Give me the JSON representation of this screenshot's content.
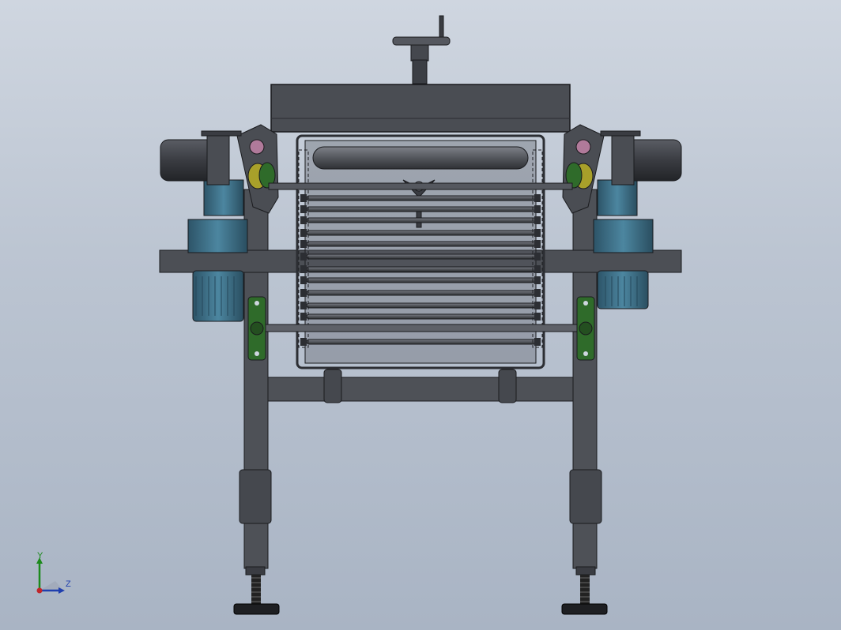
{
  "viewport": {
    "background_top": "#cfd6e0",
    "background_bottom": "#a9b4c4"
  },
  "model": {
    "subject": "roller-chain-conveyor-assembly",
    "colors": {
      "frame": "#4e5157",
      "frame_dark": "#2c2e33",
      "frame_edge": "#1a1b1e",
      "motor": "#3a3c42",
      "gearbox_blue": "#3f6f86",
      "bearing_green": "#2f6b2a",
      "coupling_yellow": "#a8a02a",
      "accent_pink": "#b07a9a",
      "foot_black": "#1e1f22"
    }
  },
  "triad": {
    "y_label": "Y",
    "z_label": "Z",
    "y_color": "#1c8a1c",
    "z_color": "#1f3fae",
    "origin_color": "#c0262b"
  }
}
